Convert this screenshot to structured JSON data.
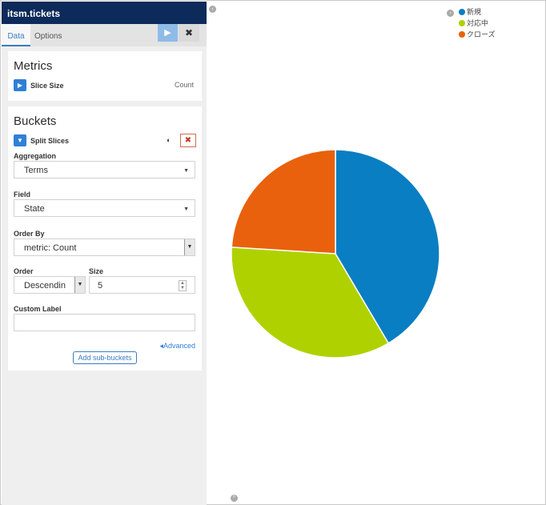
{
  "index": {
    "title": "itsm.tickets"
  },
  "tabs": [
    {
      "label": "Data"
    },
    {
      "label": "Options"
    }
  ],
  "toolbar": {
    "apply_icon": "play-icon",
    "discard_icon": "close-icon"
  },
  "metrics": {
    "heading": "Metrics",
    "agg_title": "Slice Size",
    "agg_value": "Count"
  },
  "buckets": {
    "heading": "Buckets",
    "agg_title": "Split Slices",
    "aggregation": {
      "label": "Aggregation",
      "value": "Terms"
    },
    "field": {
      "label": "Field",
      "value": "State"
    },
    "order_by": {
      "label": "Order By",
      "value": "metric: Count"
    },
    "order": {
      "label": "Order",
      "value": "Descendin"
    },
    "size": {
      "label": "Size",
      "value": "5"
    },
    "custom_label": {
      "label": "Custom Label",
      "value": ""
    },
    "advanced_link": "Advanced",
    "add_sub_buckets": "Add sub-buckets"
  },
  "colors": {
    "accent": "#2f80d6",
    "header": "#0c2a5a"
  },
  "chart_data": {
    "type": "pie",
    "categories": [
      "新規",
      "対応中",
      "クローズ"
    ],
    "values": [
      41.5,
      34.5,
      24
    ],
    "colors": [
      "#0a7ec2",
      "#b0d100",
      "#e9610c"
    ],
    "legend_position": "top-right"
  }
}
